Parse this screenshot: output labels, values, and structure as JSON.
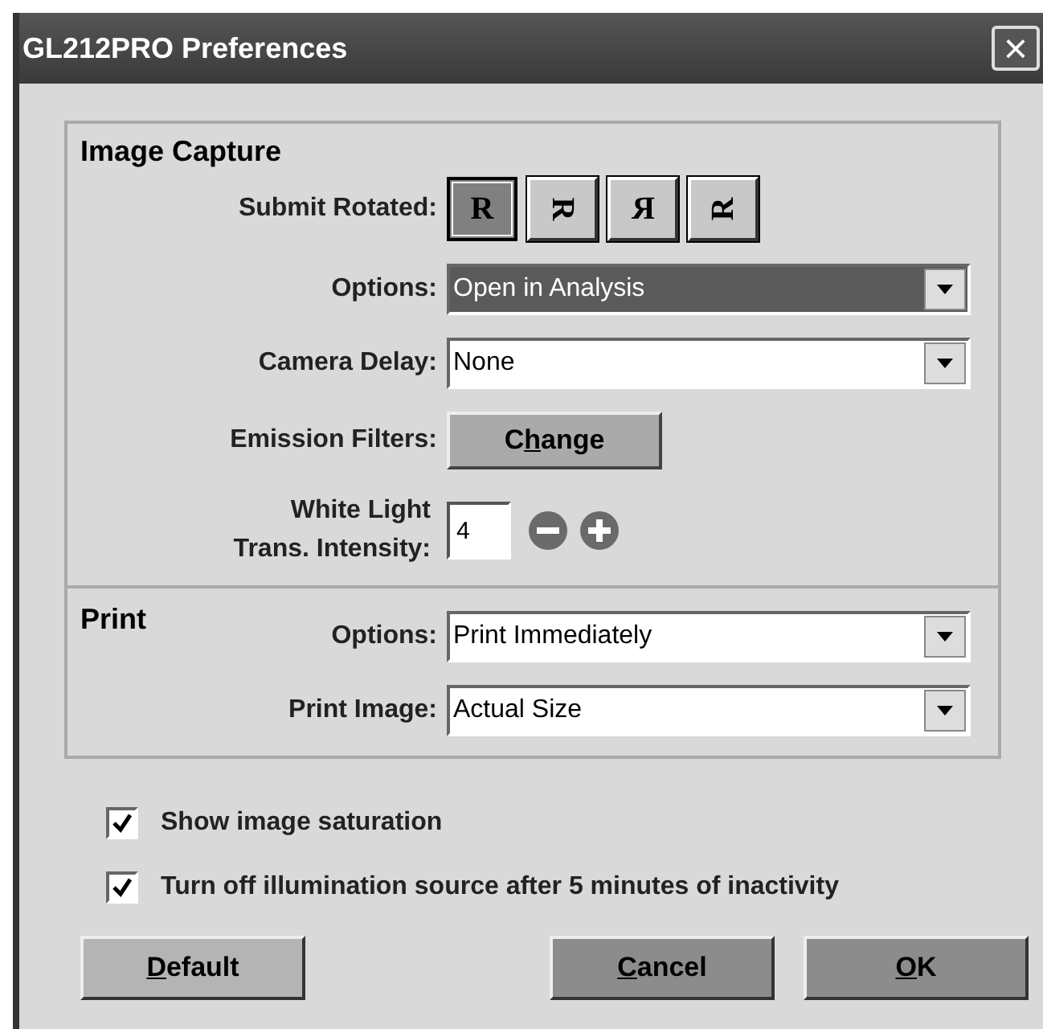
{
  "window": {
    "title": "GL212PRO Preferences",
    "close": "×"
  },
  "image_capture": {
    "heading": "Image Capture",
    "submit_rotated": {
      "label": "Submit Rotated:",
      "buttons": [
        {
          "label": "R",
          "kind": "upright",
          "selected": true
        },
        {
          "label": "R",
          "kind": "quarter",
          "selected": false
        },
        {
          "label": "R",
          "kind": "mirror",
          "selected": false
        },
        {
          "label": "R",
          "kind": "threequarter",
          "selected": false
        }
      ]
    },
    "options": {
      "label": "Options:",
      "value": "Open in Analysis",
      "focused": true
    },
    "camera_delay": {
      "label": "Camera Delay:",
      "value": "None",
      "focused": false
    },
    "emission_filters": {
      "label": "Emission Filters:",
      "button": [
        "C",
        "h",
        "ange"
      ]
    },
    "white_light": {
      "label": [
        "White Light",
        "Trans. Intensity:"
      ],
      "value": "4"
    }
  },
  "print": {
    "heading": "Print",
    "options": {
      "label": "Options:",
      "value": "Print Immediately",
      "focused": false
    },
    "print_image": {
      "label": "Print Image:",
      "value": "Actual Size",
      "focused": false
    }
  },
  "checkboxes": [
    {
      "label": "Show image saturation",
      "checked": true
    },
    {
      "label": "Turn off illumination source after 5 minutes of inactivity",
      "checked": true
    }
  ],
  "buttons": [
    {
      "parts": [
        "D",
        "efault"
      ],
      "kind": "light"
    },
    {
      "parts": [
        "C",
        "ancel"
      ],
      "kind": "dark"
    },
    {
      "parts": [
        "O",
        "K"
      ],
      "kind": "dark"
    }
  ]
}
